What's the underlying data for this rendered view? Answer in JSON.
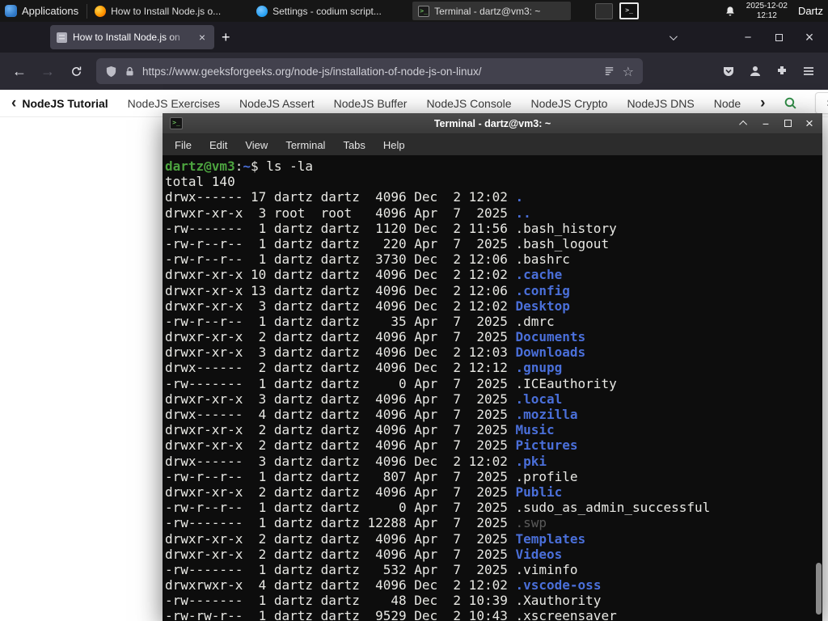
{
  "palette": {
    "term-bg": "#0d0d0d",
    "term-fg": "#e8e8e4",
    "term-green": "#4ca33f",
    "term-blue": "#4a6fd9",
    "term-dim": "#5a5a5a",
    "gfg-green": "#2f8d46"
  },
  "icons": {
    "back": "←",
    "forward": "→",
    "plus": "+",
    "close": "×",
    "minimize": "−",
    "star": "☆",
    "chevron_left": "‹",
    "chevron_right": "›",
    "terminal_glyph": ">_"
  },
  "panel": {
    "applications_label": "Applications",
    "tasks": [
      {
        "title": "How to Install Node.js o..."
      },
      {
        "title": "Settings - codium script..."
      },
      {
        "title": "Terminal - dartz@vm3: ~"
      }
    ],
    "clock_date": "2025-12-02",
    "clock_time": "12:12",
    "user": "Dartz"
  },
  "browser": {
    "tab_title": "How to Install Node.js on",
    "url": "https://www.geeksforgeeks.org/node-js/installation-of-node-js-on-linux/"
  },
  "site_nav": {
    "active": "NodeJS Tutorial",
    "items": [
      "NodeJS Exercises",
      "NodeJS Assert",
      "NodeJS Buffer",
      "NodeJS Console",
      "NodeJS Crypto",
      "NodeJS DNS",
      "Node"
    ],
    "sign_in": "Sign In"
  },
  "terminal": {
    "title": "Terminal - dartz@vm3: ~",
    "menus": [
      "File",
      "Edit",
      "View",
      "Terminal",
      "Tabs",
      "Help"
    ],
    "lines": [
      [
        [
          "dartz@vm3",
          "green"
        ],
        [
          ":",
          "fg"
        ],
        [
          "~",
          "dir"
        ],
        [
          "$",
          "fg"
        ],
        [
          " ls -la",
          "fg"
        ]
      ],
      [
        [
          "total 140",
          "fg"
        ]
      ],
      [
        [
          "drwx------ 17 dartz dartz  4096 Dec  2 12:02 ",
          "fg"
        ],
        [
          ".",
          "dir"
        ]
      ],
      [
        [
          "drwxr-xr-x  3 root  root   4096 Apr  7  2025 ",
          "fg"
        ],
        [
          "..",
          "dir"
        ]
      ],
      [
        [
          "-rw-------  1 dartz dartz  1120 Dec  2 11:56 .bash_history",
          "fg"
        ]
      ],
      [
        [
          "-rw-r--r--  1 dartz dartz   220 Apr  7  2025 .bash_logout",
          "fg"
        ]
      ],
      [
        [
          "-rw-r--r--  1 dartz dartz  3730 Dec  2 12:06 .bashrc",
          "fg"
        ]
      ],
      [
        [
          "drwxr-xr-x 10 dartz dartz  4096 Dec  2 12:02 ",
          "fg"
        ],
        [
          ".cache",
          "dir"
        ]
      ],
      [
        [
          "drwxr-xr-x 13 dartz dartz  4096 Dec  2 12:06 ",
          "fg"
        ],
        [
          ".config",
          "dir"
        ]
      ],
      [
        [
          "drwxr-xr-x  3 dartz dartz  4096 Dec  2 12:02 ",
          "fg"
        ],
        [
          "Desktop",
          "dir"
        ]
      ],
      [
        [
          "-rw-r--r--  1 dartz dartz    35 Apr  7  2025 .dmrc",
          "fg"
        ]
      ],
      [
        [
          "drwxr-xr-x  2 dartz dartz  4096 Apr  7  2025 ",
          "fg"
        ],
        [
          "Documents",
          "dir"
        ]
      ],
      [
        [
          "drwxr-xr-x  3 dartz dartz  4096 Dec  2 12:03 ",
          "fg"
        ],
        [
          "Downloads",
          "dir"
        ]
      ],
      [
        [
          "drwx------  2 dartz dartz  4096 Dec  2 12:12 ",
          "fg"
        ],
        [
          ".gnupg",
          "dir"
        ]
      ],
      [
        [
          "-rw-------  1 dartz dartz     0 Apr  7  2025 .ICEauthority",
          "fg"
        ]
      ],
      [
        [
          "drwxr-xr-x  3 dartz dartz  4096 Apr  7  2025 ",
          "fg"
        ],
        [
          ".local",
          "dir"
        ]
      ],
      [
        [
          "drwx------  4 dartz dartz  4096 Apr  7  2025 ",
          "fg"
        ],
        [
          ".mozilla",
          "dir"
        ]
      ],
      [
        [
          "drwxr-xr-x  2 dartz dartz  4096 Apr  7  2025 ",
          "fg"
        ],
        [
          "Music",
          "dir"
        ]
      ],
      [
        [
          "drwxr-xr-x  2 dartz dartz  4096 Apr  7  2025 ",
          "fg"
        ],
        [
          "Pictures",
          "dir"
        ]
      ],
      [
        [
          "drwx------  3 dartz dartz  4096 Dec  2 12:02 ",
          "fg"
        ],
        [
          ".pki",
          "dir"
        ]
      ],
      [
        [
          "-rw-r--r--  1 dartz dartz   807 Apr  7  2025 .profile",
          "fg"
        ]
      ],
      [
        [
          "drwxr-xr-x  2 dartz dartz  4096 Apr  7  2025 ",
          "fg"
        ],
        [
          "Public",
          "dir"
        ]
      ],
      [
        [
          "-rw-r--r--  1 dartz dartz     0 Apr  7  2025 .sudo_as_admin_successful",
          "fg"
        ]
      ],
      [
        [
          "-rw-------  1 dartz dartz 12288 Apr  7  2025 ",
          "fg"
        ],
        [
          ".swp",
          "dim"
        ]
      ],
      [
        [
          "drwxr-xr-x  2 dartz dartz  4096 Apr  7  2025 ",
          "fg"
        ],
        [
          "Templates",
          "dir"
        ]
      ],
      [
        [
          "drwxr-xr-x  2 dartz dartz  4096 Apr  7  2025 ",
          "fg"
        ],
        [
          "Videos",
          "dir"
        ]
      ],
      [
        [
          "-rw-------  1 dartz dartz   532 Apr  7  2025 .viminfo",
          "fg"
        ]
      ],
      [
        [
          "drwxrwxr-x  4 dartz dartz  4096 Dec  2 12:02 ",
          "fg"
        ],
        [
          ".vscode-oss",
          "dir"
        ]
      ],
      [
        [
          "-rw-------  1 dartz dartz    48 Dec  2 10:39 .Xauthority",
          "fg"
        ]
      ],
      [
        [
          "-rw-rw-r--  1 dartz dartz  9529 Dec  2 10:43 .xscreensaver",
          "fg"
        ]
      ]
    ]
  }
}
